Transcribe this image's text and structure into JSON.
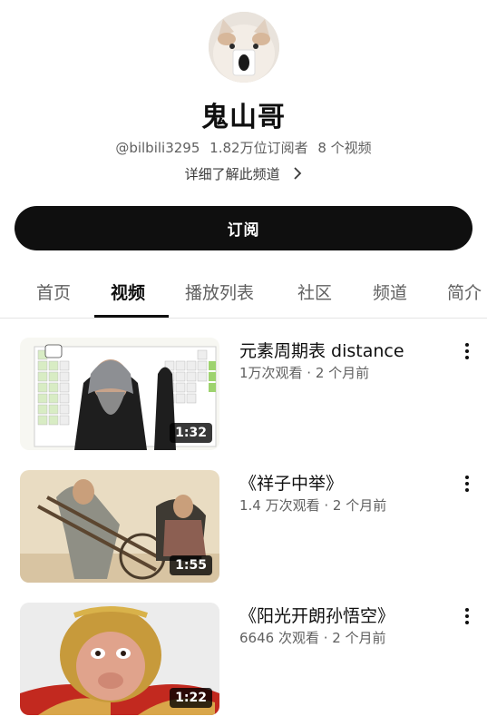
{
  "channel": {
    "name": "鬼山哥",
    "handle": "@bilbili3295",
    "subscribers": "1.82万位订阅者",
    "video_count": "8 个视频",
    "more_link": "详细了解此频道"
  },
  "subscribe_label": "订阅",
  "tabs": [
    {
      "label": "首页"
    },
    {
      "label": "视频"
    },
    {
      "label": "播放列表"
    },
    {
      "label": "社区"
    },
    {
      "label": "频道"
    },
    {
      "label": "简介"
    }
  ],
  "active_tab": "视频",
  "videos": [
    {
      "title": "元素周期表 distance",
      "meta": "1万次观看 · 2 个月前",
      "duration": "1:32"
    },
    {
      "title": "《祥子中举》",
      "meta": "1.4 万次观看 · 2 个月前",
      "duration": "1:55"
    },
    {
      "title": "《阳光开朗孙悟空》",
      "meta": "6646 次观看 · 2 个月前",
      "duration": "1:22"
    }
  ],
  "colors": {
    "subscribe_bg": "#0f0f0f",
    "secondary_text": "#606060",
    "divider": "#e5e5e5"
  }
}
